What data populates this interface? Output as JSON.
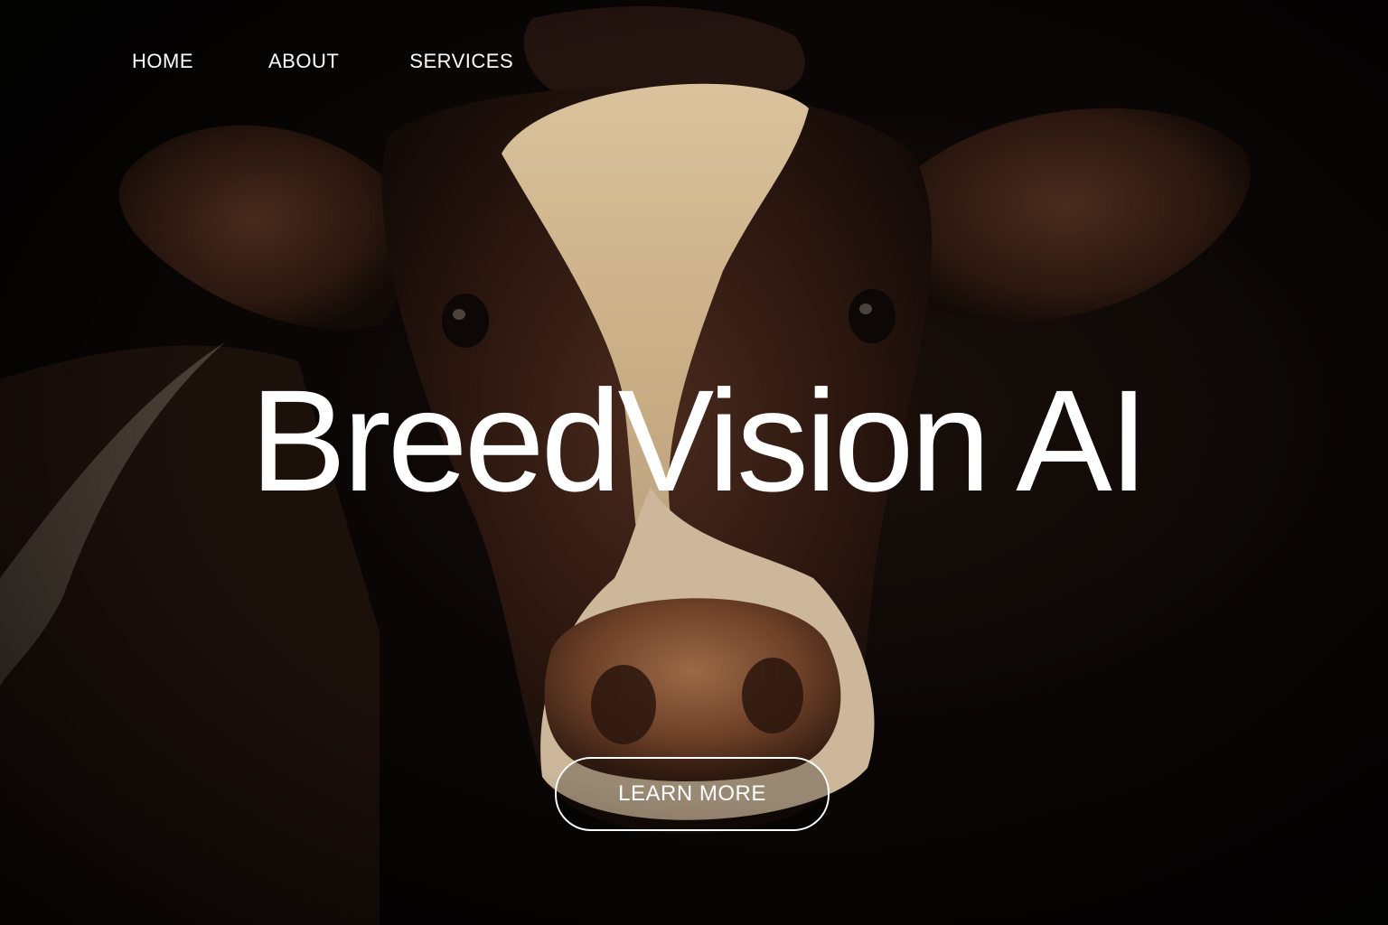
{
  "nav": {
    "items": [
      {
        "label": "HOME"
      },
      {
        "label": "ABOUT"
      },
      {
        "label": "SERVICES"
      }
    ]
  },
  "hero": {
    "title": "BreedVision AI",
    "image": "cow-portrait-image",
    "cta_label": "LEARN MORE"
  },
  "colors": {
    "background": "#060403",
    "text": "#ffffff",
    "cow_brown": "#3b2117",
    "cow_cream": "#d9c3a0",
    "nose": "#8a5a3a"
  }
}
